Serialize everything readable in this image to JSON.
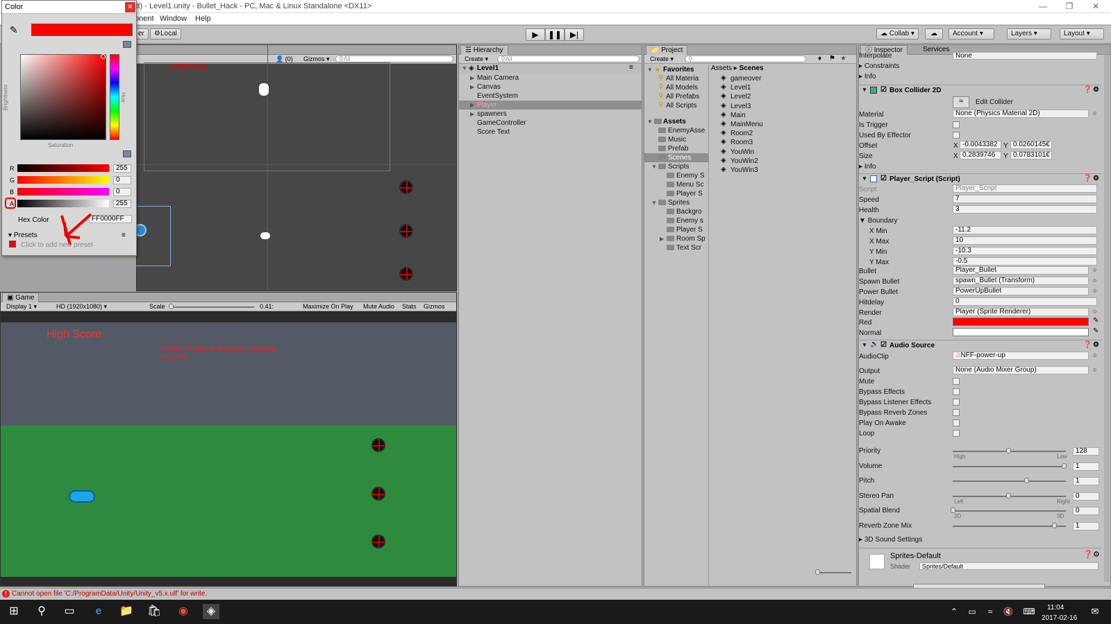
{
  "title_bar": {
    "text": "bit) - Level1.unity - Bullet_Hack - PC, Mac & Linux Standalone <DX11>"
  },
  "menu": [
    "onent",
    "Window",
    "Help"
  ],
  "toolbar": {
    "left_buttons": [
      "er",
      "Local"
    ],
    "collab": "Collab",
    "account": "Account",
    "layers": "Layers",
    "layout": "Layout",
    "play_icon": "play-icon",
    "pause_icon": "pause-icon",
    "step_icon": "step-icon"
  },
  "color_picker": {
    "title": "Color",
    "swatch_color": "#ff0000",
    "brightness_label": "Brightness",
    "hue_label": "Hue",
    "saturation_label": "Saturation",
    "channels": [
      {
        "label": "R",
        "value": "255"
      },
      {
        "label": "G",
        "value": "0"
      },
      {
        "label": "B",
        "value": "0"
      },
      {
        "label": "A",
        "value": "255"
      }
    ],
    "hex_label": "Hex Color",
    "hex_value": "FF0000FF",
    "presets_label": "Presets",
    "add_preset": "Click to add new preset"
  },
  "scene": {
    "toolbar_persp": "(0)",
    "gizmos": "Gizmos",
    "search": "All",
    "overlay_text": "progress."
  },
  "game": {
    "tab": "Game",
    "display": "Display 1",
    "resolution": "HD (1920x1080)",
    "scale_label": "Scale",
    "scale_value": "0.41:",
    "buttons": [
      "Maximize On Play",
      "Mute Audio",
      "Stats",
      "Gizmos"
    ],
    "high_score": "High Score",
    "note": "A Static Picture or Animation showing progress.",
    "sky_color": "#535a66",
    "ground_color": "#2e8b3e"
  },
  "hierarchy": {
    "tab": "Hierarchy",
    "create": "Create",
    "search": "All",
    "root": "Level1",
    "items": [
      {
        "label": "Main Camera",
        "expand": true,
        "selected": false
      },
      {
        "label": "Canvas",
        "expand": true,
        "selected": false
      },
      {
        "label": "EventSystem",
        "expand": false,
        "selected": false
      },
      {
        "label": "Player",
        "expand": true,
        "selected": true
      },
      {
        "label": "spawners",
        "expand": true,
        "selected": false
      },
      {
        "label": "GameController",
        "expand": false,
        "selected": false
      },
      {
        "label": "Score Text",
        "expand": false,
        "selected": false
      }
    ]
  },
  "project": {
    "tab": "Project",
    "create": "Create",
    "favorites_label": "Favorites",
    "favorites": [
      "All Materia",
      "All Models",
      "All Prefabs",
      "All Scripts"
    ],
    "assets_label": "Assets",
    "tree": [
      {
        "label": "EnemyAsse",
        "indent": 1
      },
      {
        "label": "Music",
        "indent": 1
      },
      {
        "label": "Prefab",
        "indent": 1
      },
      {
        "label": "Scenes",
        "indent": 1
      },
      {
        "label": "Scripts",
        "indent": 1
      },
      {
        "label": "Enemy S",
        "indent": 2
      },
      {
        "label": "Menu Sc",
        "indent": 2
      },
      {
        "label": "Player S",
        "indent": 2
      },
      {
        "label": "Sprites",
        "indent": 1
      },
      {
        "label": "Backgro",
        "indent": 2
      },
      {
        "label": "Enemy s",
        "indent": 2
      },
      {
        "label": "Player S",
        "indent": 2
      },
      {
        "label": "Room Sp",
        "indent": 2
      },
      {
        "label": "Text Scr",
        "indent": 2
      }
    ],
    "breadcrumb": [
      "Assets",
      "Scenes"
    ],
    "scenes": [
      "gameover",
      "Level1",
      "Level2",
      "Level3",
      "Main",
      "MainMenu",
      "Room2",
      "Room3",
      "YouWin",
      "YouWin2",
      "YouWin3"
    ]
  },
  "inspector": {
    "tab": "Inspector",
    "tab2": "Services",
    "interpolate_label": "Interpolate",
    "interpolate_value": "None",
    "constraints": "Constraints",
    "info": "Info",
    "box_collider": {
      "title": "Box Collider 2D",
      "edit_collider": "Edit Collider",
      "material_label": "Material",
      "material_value": "None (Physics Material 2D)",
      "is_trigger": "Is Trigger",
      "used_by_effector": "Used By Effector",
      "offset_label": "Offset",
      "offset_x": "-0.0043382",
      "offset_y": "0.0260145€",
      "size_label": "Size",
      "size_x": "0.2839746",
      "size_y": "0.0783101€",
      "info": "Info"
    },
    "player_script": {
      "title": "Player_Script (Script)",
      "fields": [
        {
          "label": "Script",
          "value": "Player_Script"
        },
        {
          "label": "Speed",
          "value": "7"
        },
        {
          "label": "Health",
          "value": "3"
        }
      ],
      "boundary_label": "Boundary",
      "boundary": [
        {
          "label": "X Min",
          "value": "-11.2"
        },
        {
          "label": "X Max",
          "value": "10"
        },
        {
          "label": "Y Min",
          "value": "-10.3"
        },
        {
          "label": "Y Max",
          "value": "-0.5"
        }
      ],
      "refs": [
        {
          "label": "Bullet",
          "value": "Player_Bullet"
        },
        {
          "label": "Spawn Bullet",
          "value": "spawn_Bullet (Transform)"
        },
        {
          "label": "Power Bullet",
          "value": "PowerUpBullet"
        },
        {
          "label": "Hitdelay",
          "value": "0"
        },
        {
          "label": "Render",
          "value": "Player (Sprite Renderer)"
        }
      ],
      "red_label": "Red",
      "red_color": "#ff0000",
      "normal_label": "Normal",
      "normal_color": "#ffffff"
    },
    "audio_source": {
      "title": "Audio Source",
      "audioclip_label": "AudioClip",
      "audioclip_value": "NFF-power-up",
      "output_label": "Output",
      "output_value": "None (Audio Mixer Group)",
      "checkboxes": [
        "Mute",
        "Bypass Effects",
        "Bypass Listener Effects",
        "Bypass Reverb Zones",
        "Play On Awake",
        "Loop"
      ],
      "sliders": [
        {
          "label": "Priority",
          "value": "128",
          "fraction": 0.5,
          "low": "High",
          "high": "Low"
        },
        {
          "label": "Volume",
          "value": "1",
          "fraction": 1.0,
          "low": "",
          "high": ""
        },
        {
          "label": "Pitch",
          "value": "1",
          "fraction": 0.66,
          "low": "",
          "high": ""
        },
        {
          "label": "Stereo Pan",
          "value": "0",
          "fraction": 0.5,
          "low": "Left",
          "high": "Right"
        },
        {
          "label": "Spatial Blend",
          "value": "0",
          "fraction": 0.0,
          "low": "2D",
          "high": "3D"
        },
        {
          "label": "Reverb Zone Mix",
          "value": "1",
          "fraction": 0.91,
          "low": "",
          "high": ""
        }
      ],
      "sound3d": "3D Sound Settings"
    },
    "material": {
      "name": "Sprites-Default",
      "shader_label": "Shader",
      "shader_value": "Sprites/Default"
    }
  },
  "status": {
    "error": "Cannot open file 'C:/ProgramData/Unity/Unity_v5.x.ulf' for write."
  },
  "taskbar": {
    "time": "11:04",
    "date": "2017-02-16"
  }
}
